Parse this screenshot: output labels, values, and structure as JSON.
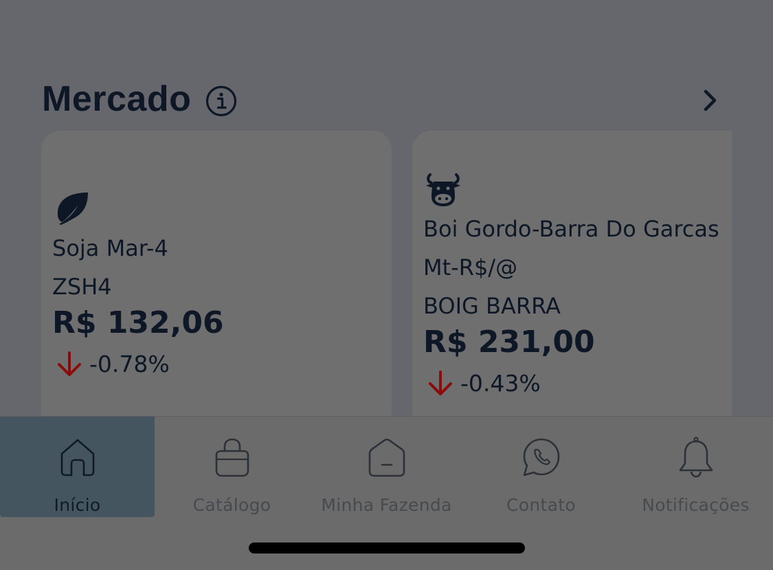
{
  "market": {
    "title": "Mercado",
    "info_icon": "info-circle-icon",
    "more_icon": "chevron-right-icon",
    "cards": [
      {
        "icon": "leaf-icon",
        "name": "Soja Mar-4",
        "code": "ZSH4",
        "price": "R$ 132,06",
        "change": "-0.78%",
        "trend": "down"
      },
      {
        "icon": "cow-icon",
        "name_line1": "Boi Gordo-Barra Do Garcas",
        "name_line2": "Mt-R$/@",
        "code": "BOIG BARRA",
        "price": "R$ 231,00",
        "change": "-0.43%",
        "trend": "down"
      }
    ]
  },
  "tabbar": {
    "tabs": [
      {
        "label": "Início",
        "icon": "home-icon",
        "active": true
      },
      {
        "label": "Catálogo",
        "icon": "shopping-bag-icon",
        "active": false
      },
      {
        "label": "Minha Fazenda",
        "icon": "farm-house-icon",
        "active": false
      },
      {
        "label": "Contato",
        "icon": "whatsapp-icon",
        "active": false
      },
      {
        "label": "Notificações",
        "icon": "bell-icon",
        "active": false
      }
    ]
  },
  "colors": {
    "overlay_bg": "#66676d",
    "text_dark": "#0d1726",
    "trend_down": "#8b0a0a",
    "active_tab": "#455560"
  }
}
